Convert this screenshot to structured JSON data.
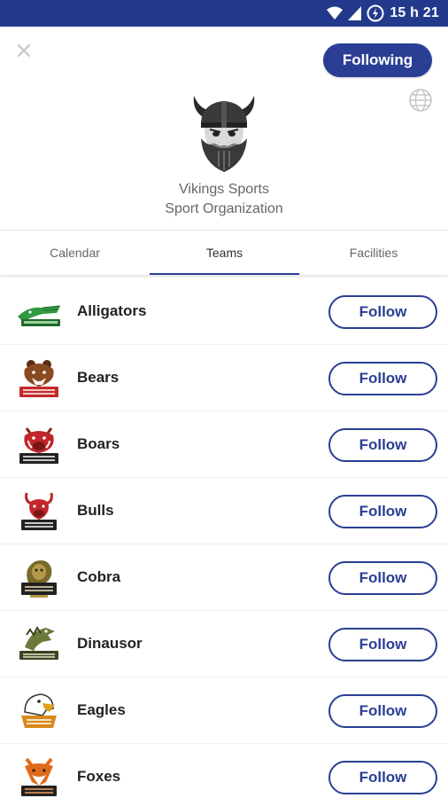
{
  "status_bar": {
    "time": "15 h 21"
  },
  "header": {
    "following_label": "Following",
    "org_name": "Vikings Sports",
    "org_type": "Sport Organization"
  },
  "tabs": [
    {
      "label": "Calendar"
    },
    {
      "label": "Teams",
      "selected": true
    },
    {
      "label": "Facilities"
    }
  ],
  "teams": [
    {
      "name": "Alligators",
      "follow_label": "Follow",
      "logo_color": "#2f9a3f"
    },
    {
      "name": "Bears",
      "follow_label": "Follow",
      "logo_color": "#8a4a22"
    },
    {
      "name": "Boars",
      "follow_label": "Follow",
      "logo_color": "#c0262b"
    },
    {
      "name": "Bulls",
      "follow_label": "Follow",
      "logo_color": "#c0262b"
    },
    {
      "name": "Cobra",
      "follow_label": "Follow",
      "logo_color": "#7a6a2a"
    },
    {
      "name": "Dinausor",
      "follow_label": "Follow",
      "logo_color": "#6b7a3a"
    },
    {
      "name": "Eagles",
      "follow_label": "Follow",
      "logo_color": "#d98a1a"
    },
    {
      "name": "Foxes",
      "follow_label": "Follow",
      "logo_color": "#e06a1a"
    }
  ],
  "colors": {
    "primary": "#2a3f94",
    "status_bar": "#233a8c"
  }
}
